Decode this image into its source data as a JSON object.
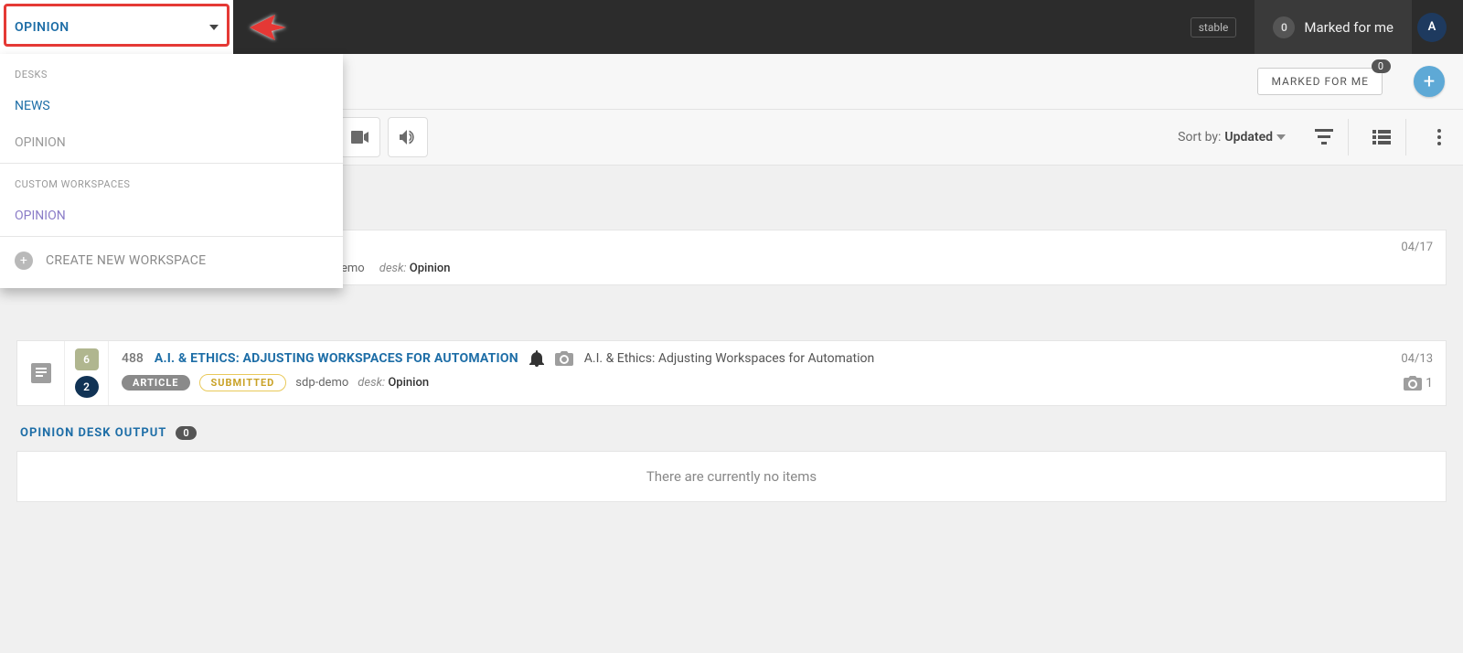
{
  "topbar": {
    "desk_selector_label": "OPINION",
    "stable_label": "stable",
    "marked_count": "0",
    "marked_label": "Marked for me",
    "avatar_letter": "A"
  },
  "dropdown": {
    "desks_label": "DESKS",
    "items_desks": [
      {
        "label": "NEWS"
      },
      {
        "label": "OPINION"
      }
    ],
    "workspaces_label": "CUSTOM WORKSPACES",
    "items_workspaces": [
      {
        "label": "OPINION"
      }
    ],
    "create_label": "CREATE NEW WORKSPACE"
  },
  "subnav": {
    "marked_button": "MARKED FOR ME",
    "marked_button_count": "0"
  },
  "toolbar": {
    "sort_label": "Sort by:",
    "sort_value": "Updated"
  },
  "cards": [
    {
      "date": "04/17",
      "author_partial": "emo",
      "desk_label": "desk:",
      "desk_value": "Opinion"
    },
    {
      "id": "488",
      "slug": "A.I. & ETHICS: ADJUSTING WORKSPACES FOR AUTOMATION",
      "headline": "A.I. & Ethics: Adjusting Workspaces for Automation",
      "date": "04/13",
      "badge_top": "6",
      "badge_bottom": "2",
      "pill_article": "ARTICLE",
      "pill_submitted": "SUBMITTED",
      "author": "sdp-demo",
      "desk_label": "desk:",
      "desk_value": "Opinion",
      "pic_count": "1"
    }
  ],
  "output_section": {
    "title": "OPINION DESK OUTPUT",
    "count": "0",
    "empty_text": "There are currently no items"
  }
}
